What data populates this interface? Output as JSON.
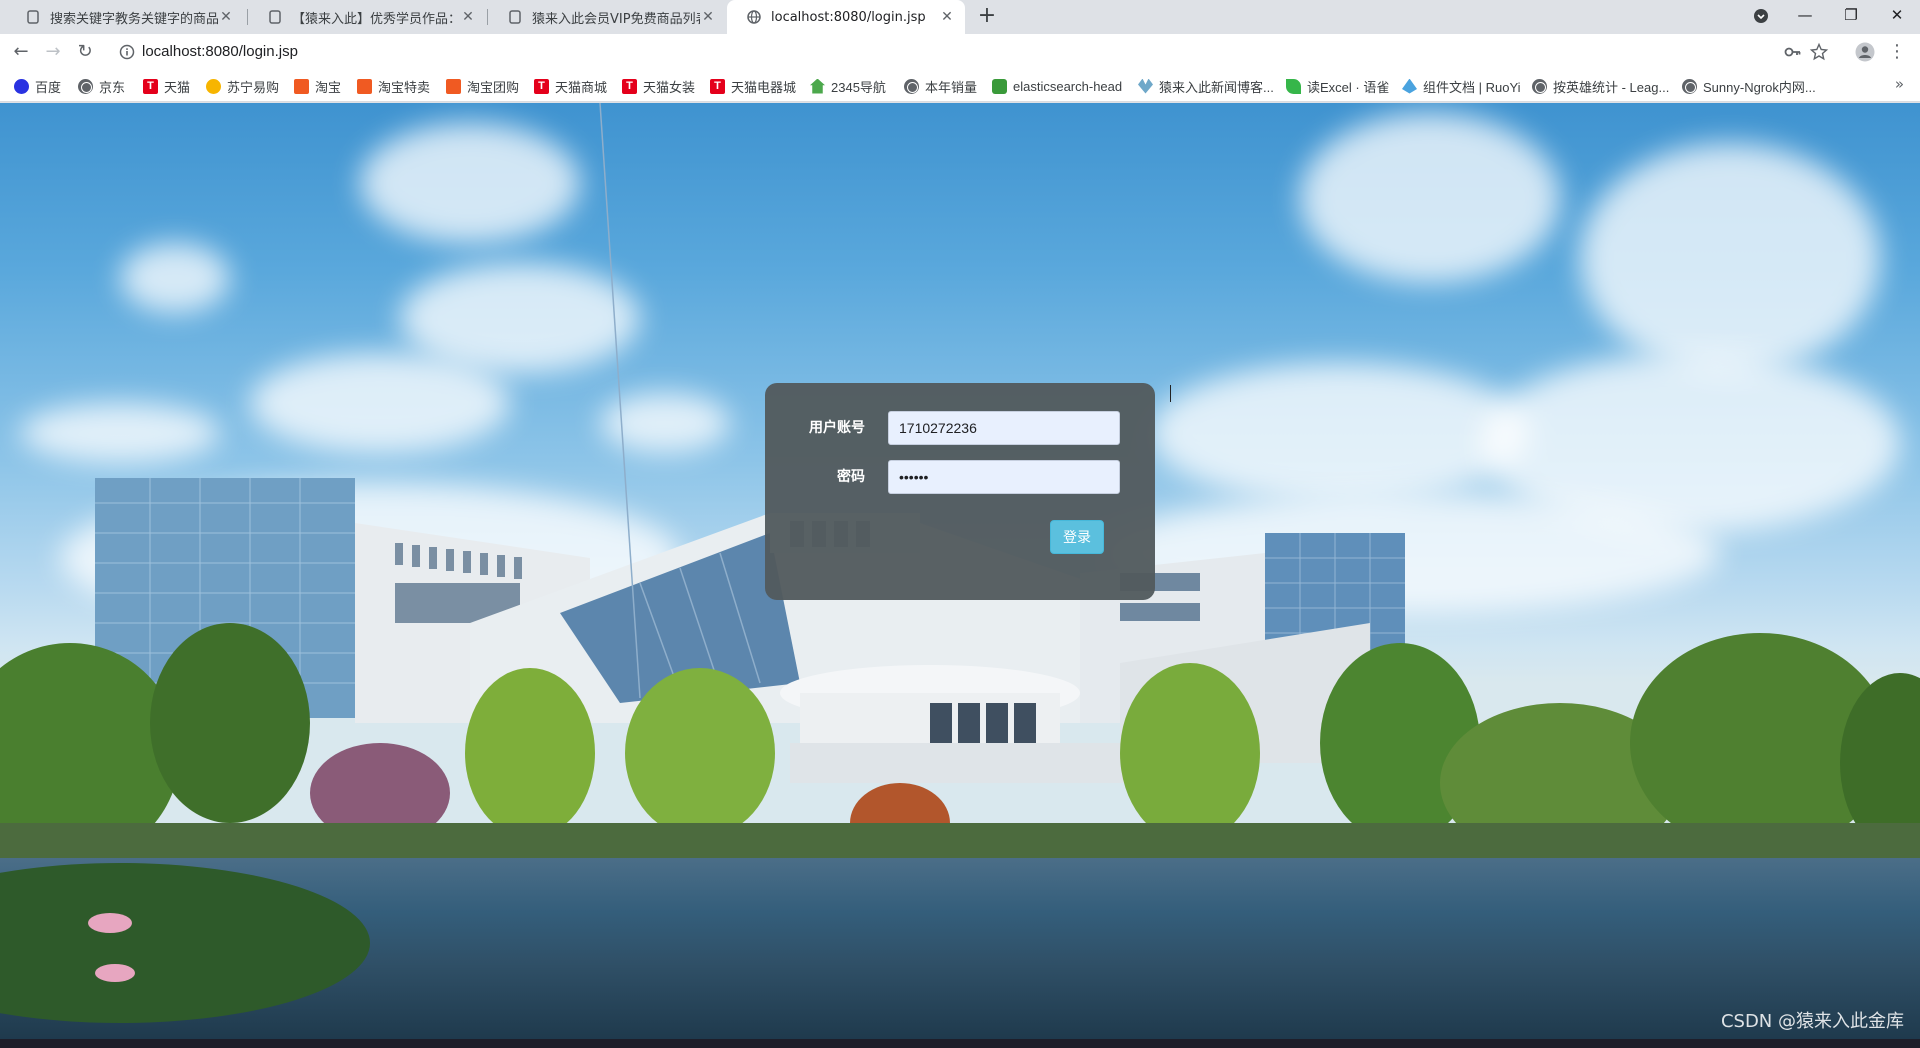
{
  "browser": {
    "tabs": [
      {
        "title": "搜索关键字教务关键字的商品列表",
        "active": false
      },
      {
        "title": "【猿来入此】优秀学员作品：Spr",
        "active": false
      },
      {
        "title": "猿来入此会员VIP免费商品列表",
        "active": false
      },
      {
        "title": "localhost:8080/login.jsp",
        "active": true
      }
    ],
    "new_tab_symbol": "+",
    "url": "localhost:8080/login.jsp",
    "bookmarks": [
      {
        "label": "百度",
        "icon": "paw-icon"
      },
      {
        "label": "京东",
        "icon": "globe-icon"
      },
      {
        "label": "天猫",
        "icon": "tmall-icon"
      },
      {
        "label": "苏宁易购",
        "icon": "suning-icon"
      },
      {
        "label": "淘宝",
        "icon": "taobao-icon"
      },
      {
        "label": "淘宝特卖",
        "icon": "taobao-icon"
      },
      {
        "label": "淘宝团购",
        "icon": "taobao-icon"
      },
      {
        "label": "天猫商城",
        "icon": "tmall-icon"
      },
      {
        "label": "天猫女装",
        "icon": "tmall-icon"
      },
      {
        "label": "天猫电器城",
        "icon": "tmall-icon"
      },
      {
        "label": "2345导航",
        "icon": "house-icon"
      },
      {
        "label": "本年销量",
        "icon": "globe-icon"
      },
      {
        "label": "elasticsearch-head",
        "icon": "es-icon"
      },
      {
        "label": "猿来入此新闻博客...",
        "icon": "ape-icon"
      },
      {
        "label": "读Excel · 语雀",
        "icon": "leaf-icon"
      },
      {
        "label": "组件文档 | RuoYi",
        "icon": "ruoyi-icon"
      },
      {
        "label": "按英雄统计 - Leag...",
        "icon": "globe-icon"
      },
      {
        "label": "Sunny-Ngrok内网...",
        "icon": "globe-icon"
      }
    ],
    "bookmark_overflow": "»"
  },
  "login": {
    "account_label": "用户账号",
    "account_value": "1710272236",
    "password_label": "密码",
    "password_value": "••••••",
    "submit_label": "登录"
  },
  "watermark": "CSDN @猿来入此金库"
}
